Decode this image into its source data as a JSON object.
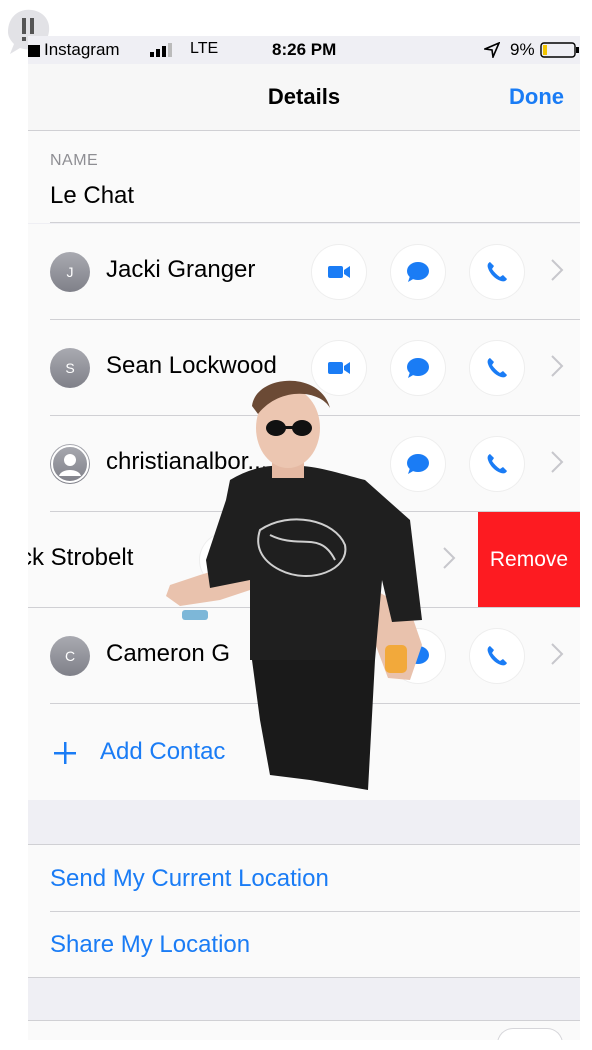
{
  "status": {
    "carrier": "Instagram",
    "network": "LTE",
    "time": "8:26 PM",
    "battery": "9%"
  },
  "nav": {
    "title": "Details",
    "done": "Done"
  },
  "name_section": {
    "caption": "NAME",
    "value": "Le Chat"
  },
  "contacts": [
    {
      "initial": "J",
      "name": "Jacki Granger"
    },
    {
      "initial": "S",
      "name": "Sean Lockwood"
    },
    {
      "initial": "",
      "name": "christianalbor..."
    },
    {
      "initial": "",
      "name": "ck Strobelt",
      "action": "Remove"
    },
    {
      "initial": "C",
      "name": "Cameron G"
    }
  ],
  "add_contact": "Add Contac",
  "location": {
    "send": "Send My Current Location",
    "share": "Share My Location"
  },
  "colors": {
    "accent": "#1a7cf5",
    "remove": "#fd1b21",
    "avatar": "#8e8e93"
  },
  "icons": {
    "video": "video-icon",
    "message": "message-icon",
    "phone": "phone-icon",
    "chevron": "chevron-right-icon"
  }
}
